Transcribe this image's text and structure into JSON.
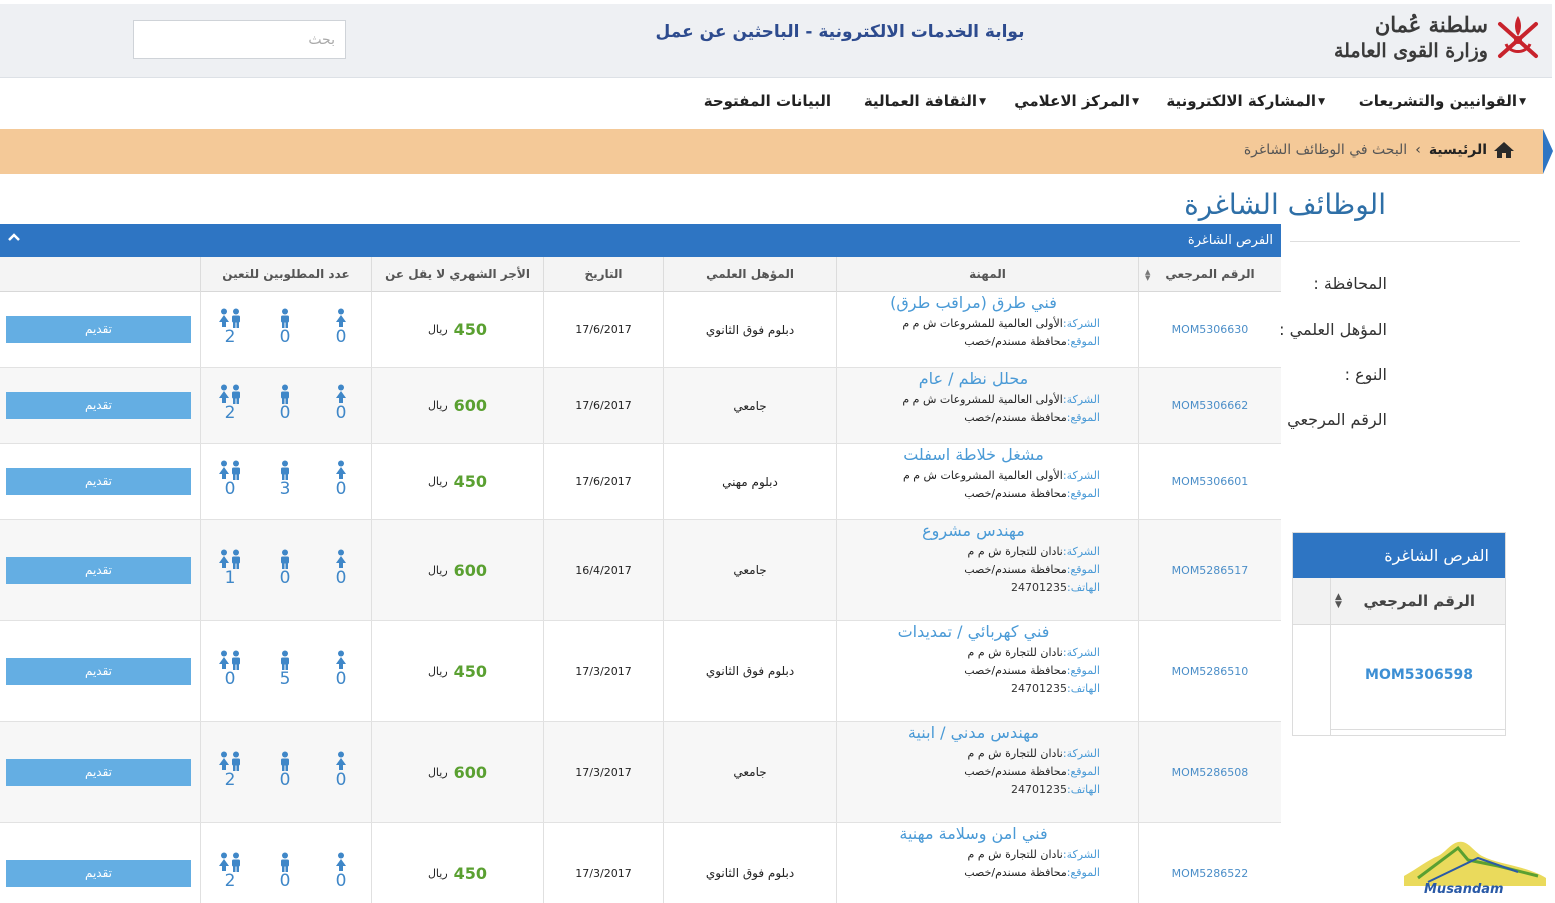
{
  "header": {
    "portal_title": "بوابة الخدمات الالكترونية - الباحثين عن عمل",
    "search_placeholder": "بحث",
    "logo_line1": "سلطنة عُمان",
    "logo_line2": "وزارة القوى العاملة"
  },
  "nav": {
    "items": [
      {
        "label": "القوانيين والتشريعات",
        "has_dropdown": true
      },
      {
        "label": "المشاركة الالكترونية",
        "has_dropdown": true
      },
      {
        "label": "المركز الاعلامي",
        "has_dropdown": true
      },
      {
        "label": "الثقافة العمالية",
        "has_dropdown": true
      },
      {
        "label": "البيانات المفتوحة",
        "has_dropdown": false
      }
    ]
  },
  "breadcrumb": {
    "home": "الرئيسية",
    "separator": "›",
    "current": "البحث في الوظائف الشاغرة"
  },
  "page": {
    "title": "الوظائف الشاغرة"
  },
  "filters": {
    "governorate": "المحافظة :",
    "qualification": "المؤهل العلمي :",
    "gender": "النوع :",
    "reference": "الرقم المرجعي :"
  },
  "side_panel": {
    "title": "الفرص الشاغرة",
    "column": "الرقم المرجعي",
    "first_ref": "MOM5306598"
  },
  "table": {
    "caption": "الفرص الشاغرة",
    "collapse_icon": "chevron-up-icon",
    "columns": {
      "ref": "الرقم المرجعي",
      "job": "المهنة",
      "qualification": "المؤهل العلمي",
      "date": "التاريخ",
      "salary": "الأجر الشهري لا يقل عن",
      "count": "عدد المطلوبين للتعين"
    },
    "labels": {
      "company": "الشركة:",
      "location": "الموقع:",
      "phone": "الهاتف:",
      "currency": "ريال",
      "apply": "تقديم"
    },
    "rows": [
      {
        "ref": "MOM5306630",
        "title": "فني طرق (مراقب طرق)",
        "company": "الأولى العالمية للمشروعات ش م م",
        "location": "محافظة مسندم/خصب",
        "phone": "",
        "qualification": "دبلوم فوق الثانوي",
        "date": "17/6/2017",
        "salary": "450",
        "female": "0",
        "male": "0",
        "any": "2"
      },
      {
        "ref": "MOM5306662",
        "title": "محلل نظم / عام",
        "company": "الأولى العالمية للمشروعات ش م م",
        "location": "محافظة مسندم/خصب",
        "phone": "",
        "qualification": "جامعي",
        "date": "17/6/2017",
        "salary": "600",
        "female": "0",
        "male": "0",
        "any": "2"
      },
      {
        "ref": "MOM5306601",
        "title": "مشغل خلاطة اسفلت",
        "company": "الأولى العالمية المشروعات ش م م",
        "location": "محافظة مسندم/خصب",
        "phone": "",
        "qualification": "دبلوم مهني",
        "date": "17/6/2017",
        "salary": "450",
        "female": "0",
        "male": "3",
        "any": "0"
      },
      {
        "ref": "MOM5286517",
        "title": "مهندس مشروع",
        "company": "نادان للتجارة ش م م",
        "location": "محافظة مسندم/خصب",
        "phone": "24701235",
        "qualification": "جامعي",
        "date": "16/4/2017",
        "salary": "600",
        "female": "0",
        "male": "0",
        "any": "1"
      },
      {
        "ref": "MOM5286510",
        "title": "فني كهربائي / تمديدات",
        "company": "نادان للتجارة ش م م",
        "location": "محافظة مسندم/خصب",
        "phone": "24701235",
        "qualification": "دبلوم فوق الثانوي",
        "date": "17/3/2017",
        "salary": "450",
        "female": "0",
        "male": "5",
        "any": "0"
      },
      {
        "ref": "MOM5286508",
        "title": "مهندس مدني / ابنية",
        "company": "نادان للتجارة ش م م",
        "location": "محافظة مسندم/خصب",
        "phone": "24701235",
        "qualification": "جامعي",
        "date": "17/3/2017",
        "salary": "600",
        "female": "0",
        "male": "0",
        "any": "2"
      },
      {
        "ref": "MOM5286522",
        "title": "فني امن وسلامة مهنية",
        "company": "نادان للتجارة ش م م",
        "location": "محافظة مسندم/خصب",
        "phone": "",
        "qualification": "دبلوم فوق الثانوي",
        "date": "17/3/2017",
        "salary": "450",
        "female": "0",
        "male": "0",
        "any": "2"
      }
    ]
  },
  "watermark": {
    "text": "Musandam"
  },
  "colors": {
    "primary_blue": "#2e75c3",
    "breadcrumb_bg": "#f4c998",
    "salary_green": "#5aa031",
    "apply_button": "#64aee3",
    "link_blue": "#4a9ad6"
  }
}
